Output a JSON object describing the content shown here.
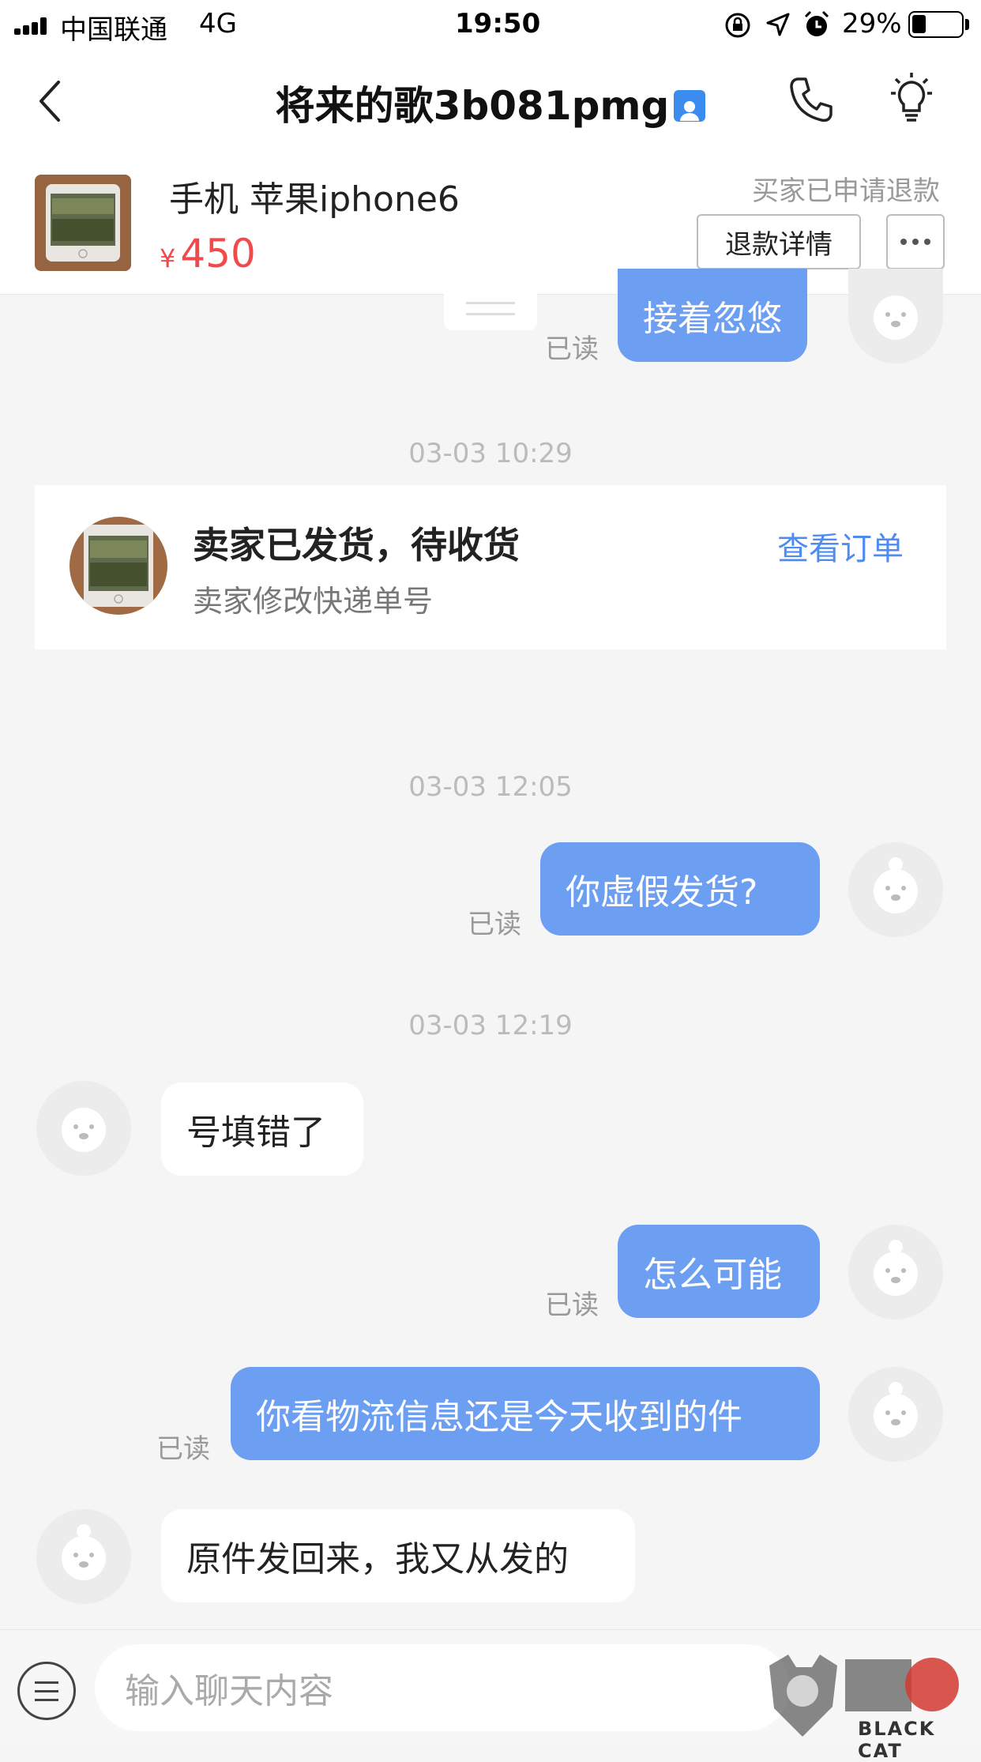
{
  "status_bar": {
    "carrier": "中国联通",
    "network": "4G",
    "time": "19:50",
    "battery": "29%",
    "battery_level": 0.29
  },
  "nav": {
    "title": "将来的歌3b081pmg"
  },
  "product": {
    "name": "手机 苹果iphone6",
    "currency": "¥",
    "price": "450",
    "status": "买家已申请退款",
    "refund_button": "退款详情"
  },
  "messages": {
    "m1": {
      "text": "接着忽悠",
      "read": "已读"
    },
    "ts1": "03-03 10:29",
    "order_card": {
      "title": "卖家已发货，待收货",
      "subtitle": "卖家修改快递单号",
      "link": "查看订单"
    },
    "ts2": "03-03 12:05",
    "m2": {
      "text": "你虚假发货?",
      "read": "已读"
    },
    "ts3": "03-03 12:19",
    "m3": {
      "text": "号填错了"
    },
    "m4": {
      "text": "怎么可能",
      "read": "已读"
    },
    "m5": {
      "text": "你看物流信息还是今天收到的件",
      "read": "已读"
    },
    "m6": {
      "text": "原件发回来，我又从发的"
    }
  },
  "input": {
    "placeholder": "输入聊天内容"
  },
  "watermark": {
    "text": "BLACK CAT"
  },
  "colors": {
    "outgoing_bubble": "#6c9ff2",
    "price": "#f24a4a",
    "link": "#4f8cf0"
  }
}
